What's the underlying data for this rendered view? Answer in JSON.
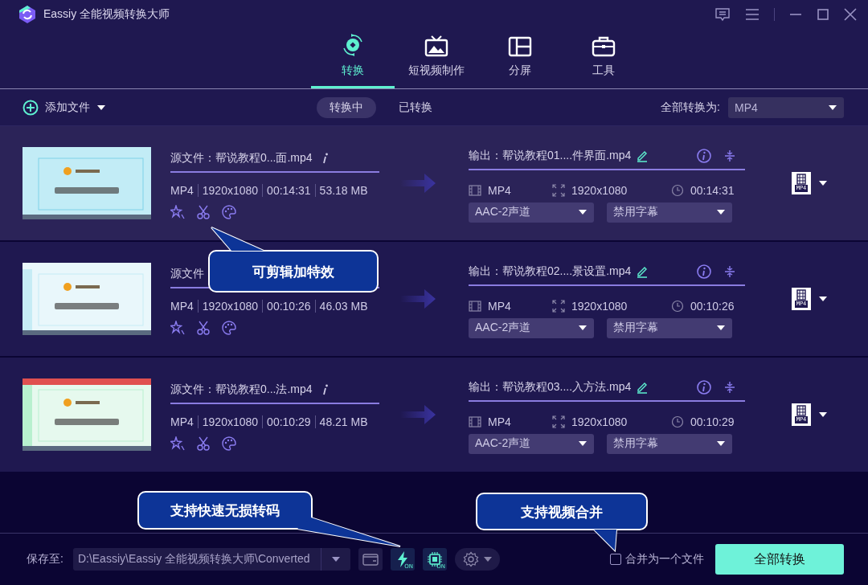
{
  "window": {
    "title": "Eassiy 全能视频转换大师"
  },
  "tabs": [
    {
      "label": "转换",
      "selected": true,
      "kind": "convert"
    },
    {
      "label": "短视频制作",
      "selected": false,
      "kind": "video"
    },
    {
      "label": "分屏",
      "selected": false,
      "kind": "split"
    },
    {
      "label": "工具",
      "selected": false,
      "kind": "tools"
    }
  ],
  "toolbar": {
    "add_file": "添加文件",
    "filters": [
      {
        "label": "转换中",
        "selected": true
      },
      {
        "label": "已转换",
        "selected": false
      }
    ],
    "convert_all_label": "全部转换为:",
    "convert_all_format": "MP4"
  },
  "files": [
    {
      "selected": true,
      "source": "源文件：帮说教程0...面.mp4",
      "meta": [
        "MP4",
        "1920x1080",
        "00:14:31",
        "53.18 MB"
      ],
      "output": "输出：帮说教程01....件界面.mp4",
      "out_format": "MP4",
      "out_resolution": "1920x1080",
      "out_duration": "00:14:31",
      "audio": "AAC-2声道",
      "subtitle": "禁用字幕",
      "format_badge": "MP4"
    },
    {
      "selected": false,
      "source": "源文件",
      "meta": [
        "MP4",
        "1920x1080",
        "00:10:26",
        "46.03 MB"
      ],
      "output": "输出：帮说教程02....景设置.mp4",
      "out_format": "MP4",
      "out_resolution": "1920x1080",
      "out_duration": "00:10:26",
      "audio": "AAC-2声道",
      "subtitle": "禁用字幕",
      "format_badge": "MP4"
    },
    {
      "selected": false,
      "source": "源文件：帮说教程0...法.mp4",
      "meta": [
        "MP4",
        "1920x1080",
        "00:10:29",
        "48.21 MB"
      ],
      "output": "输出：帮说教程03....入方法.mp4",
      "out_format": "MP4",
      "out_resolution": "1920x1080",
      "out_duration": "00:10:29",
      "audio": "AAC-2声道",
      "subtitle": "禁用字幕",
      "format_badge": "MP4"
    }
  ],
  "bottom_bar": {
    "save_label": "保存至:",
    "path": "D:\\Eassiy\\Eassiy 全能视频转换大师\\Converted",
    "accel": [
      {
        "kind": "speed",
        "badge": "ON"
      },
      {
        "kind": "hardware",
        "badge": "ON"
      }
    ],
    "merge": {
      "label": "合并为一个文件",
      "checked": false
    },
    "convert_button": "全部转换"
  },
  "callouts": [
    {
      "text": "可剪辑加特效"
    },
    {
      "text": "支持快速无损转码"
    },
    {
      "text": "支持视频合并"
    }
  ]
}
